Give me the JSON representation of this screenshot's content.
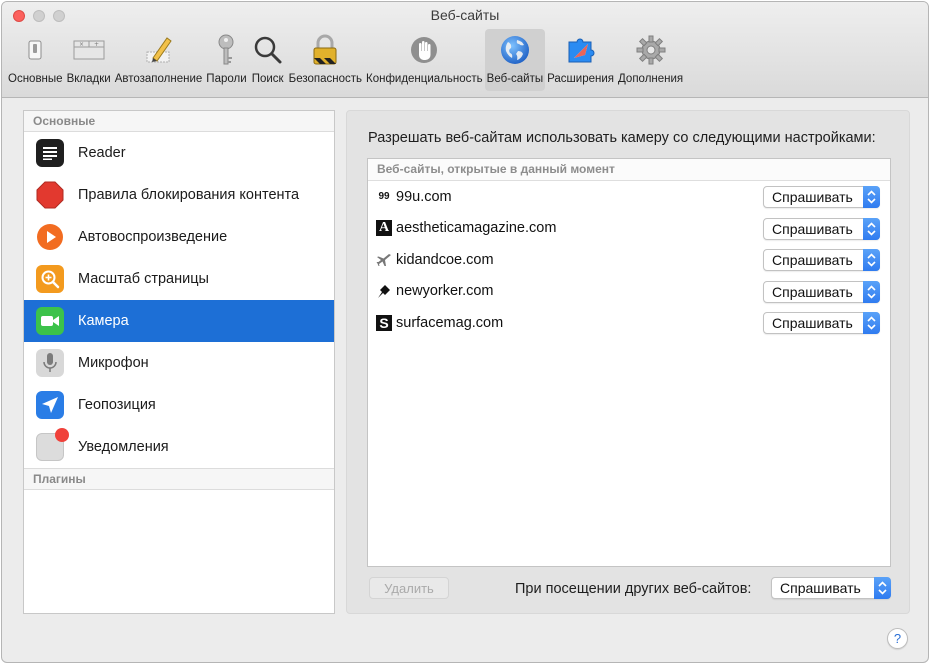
{
  "window": {
    "title": "Веб-сайты"
  },
  "toolbar": {
    "items": [
      {
        "label": "Основные",
        "icon": "general-switch-icon"
      },
      {
        "label": "Вкладки",
        "icon": "tabs-icon"
      },
      {
        "label": "Автозаполнение",
        "icon": "autofill-pencil-icon"
      },
      {
        "label": "Пароли",
        "icon": "key-icon"
      },
      {
        "label": "Поиск",
        "icon": "magnifier-icon"
      },
      {
        "label": "Безопасность",
        "icon": "padlock-icon"
      },
      {
        "label": "Конфиденциальность",
        "icon": "privacy-hand-icon"
      },
      {
        "label": "Веб-сайты",
        "icon": "globe-icon",
        "selected": true
      },
      {
        "label": "Расширения",
        "icon": "extensions-puzzle-icon"
      },
      {
        "label": "Дополнения",
        "icon": "advanced-gear-icon"
      }
    ]
  },
  "sidebar": {
    "section_general": "Основные",
    "section_plugins": "Плагины",
    "items": [
      {
        "label": "Reader",
        "icon": "reader-icon"
      },
      {
        "label": "Правила блокирования контента",
        "icon": "stop-sign-icon"
      },
      {
        "label": "Автовоспроизведение",
        "icon": "autoplay-icon"
      },
      {
        "label": "Масштаб страницы",
        "icon": "page-zoom-icon"
      },
      {
        "label": "Камера",
        "icon": "camera-icon",
        "selected": true
      },
      {
        "label": "Микрофон",
        "icon": "microphone-icon"
      },
      {
        "label": "Геопозиция",
        "icon": "location-arrow-icon"
      },
      {
        "label": "Уведомления",
        "icon": "notifications-icon"
      }
    ]
  },
  "main": {
    "heading": "Разрешать веб-сайтам использовать камеру со следующими настройками:",
    "list_header": "Веб-сайты, открытые в данный момент",
    "sites": [
      {
        "favicon": "99",
        "name": "99u.com",
        "setting": "Спрашивать"
      },
      {
        "favicon": "A",
        "name": "aestheticamagazine.com",
        "setting": "Спрашивать"
      },
      {
        "favicon": "plane",
        "name": "kidandcoe.com",
        "setting": "Спрашивать"
      },
      {
        "favicon": "pin",
        "name": "newyorker.com",
        "setting": "Спрашивать"
      },
      {
        "favicon": "S",
        "name": "surfacemag.com",
        "setting": "Спрашивать"
      }
    ],
    "remove_button": "Удалить",
    "other_sites_label": "При посещении других веб-сайтов:",
    "other_sites_value": "Спрашивать"
  },
  "help": {
    "label": "?"
  },
  "colors": {
    "selection": "#1d6fd6",
    "popup_arrow": "#3b86f3"
  }
}
